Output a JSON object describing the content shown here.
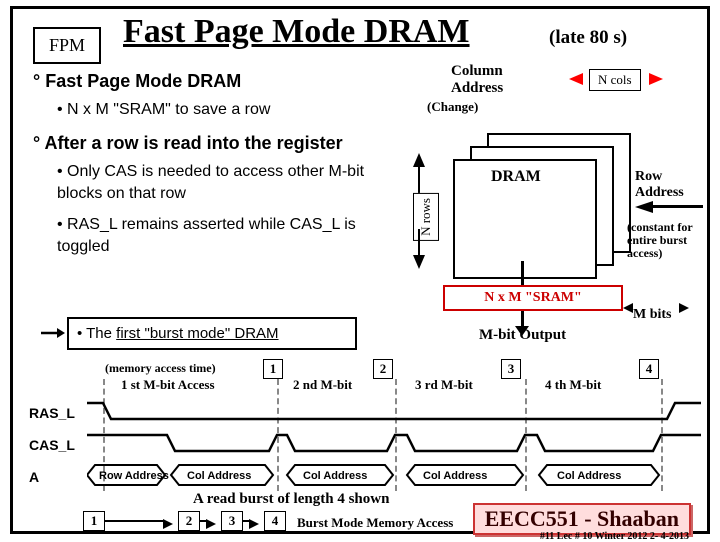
{
  "badge": "FPM",
  "title_main": "Fast Page Mode DRAM",
  "title_sub": "(late 80 s)",
  "bullets": {
    "b1a": "Fast Page Mode DRAM",
    "b2a": "N x M \"SRAM\" to save a row",
    "b1b": "After a row is read into the register",
    "b2b": "Only CAS is needed to access other M-bit blocks on that row",
    "b2c": "RAS_L remains asserted while CAS_L is toggled"
  },
  "burst_box_pre": "• The ",
  "burst_box_u": "first \"burst mode\" DRAM",
  "diagram": {
    "col_addr1": "Column",
    "col_addr2": "Address",
    "ncols": "N cols",
    "change": "(Change)",
    "nrows": "N rows",
    "dram": "DRAM",
    "row_addr1": "Row",
    "row_addr2": "Address",
    "constant": "(constant for entire burst access)",
    "sram": "N x M \"SRAM\"",
    "mbits": "M bits",
    "output": "M-bit Output"
  },
  "timing": {
    "mem_access": "(memory access time)",
    "access_labels": [
      "1 st M-bit Access",
      "2 nd M-bit",
      "3 rd M-bit",
      "4 th M-bit"
    ],
    "nums": [
      "1",
      "2",
      "3",
      "4"
    ],
    "signals": [
      "RAS_L",
      "CAS_L",
      "A"
    ],
    "addr": {
      "row": "Row Address",
      "col": "Col Address"
    }
  },
  "burst_caption": "A read burst of length 4 shown",
  "bottom_nums": [
    "1",
    "2",
    "3",
    "4"
  ],
  "burst_mode": "Burst Mode Memory Access",
  "footer_logo": "EECC551 - Shaaban",
  "footer_meta": "#11  Lec # 10 Winter 2012  2- 4-2013"
}
